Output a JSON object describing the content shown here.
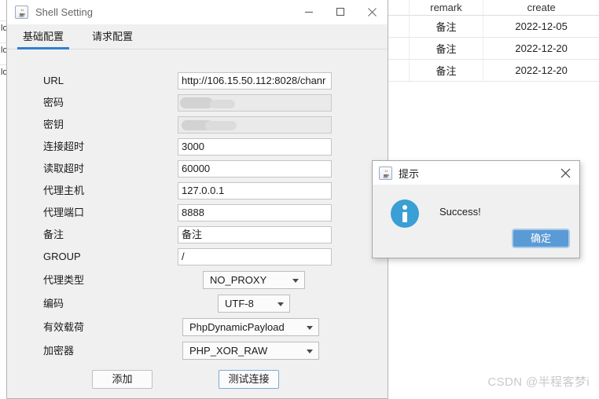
{
  "background": {
    "left_rows": [
      "lo",
      "lo",
      "lo"
    ],
    "table": {
      "headers": [
        "",
        "remark",
        "create"
      ],
      "rows": [
        [
          "",
          "备注",
          "2022-12-05"
        ],
        [
          "",
          "备注",
          "2022-12-20"
        ],
        [
          "",
          "备注",
          "2022-12-20"
        ]
      ]
    },
    "watermark": "CSDN @半程客梦i"
  },
  "shell_window": {
    "title": "Shell Setting",
    "app_icon": "java-coffee-cup-icon",
    "controls": {
      "minimize": "minimize-icon",
      "maximize": "maximize-icon",
      "close": "close-icon"
    },
    "tabs": [
      {
        "label": "基础配置",
        "active": true
      },
      {
        "label": "请求配置",
        "active": false
      }
    ],
    "fields": [
      {
        "label": "URL",
        "value": "http://106.15.50.112:8028/chanr",
        "type": "text"
      },
      {
        "label": "密码",
        "value": "",
        "type": "masked"
      },
      {
        "label": "密钥",
        "value": "",
        "type": "masked"
      },
      {
        "label": "连接超时",
        "value": "3000",
        "type": "text"
      },
      {
        "label": "读取超时",
        "value": "60000",
        "type": "text"
      },
      {
        "label": "代理主机",
        "value": "127.0.0.1",
        "type": "text"
      },
      {
        "label": "代理端口",
        "value": "8888",
        "type": "text"
      },
      {
        "label": "备注",
        "value": "备注",
        "type": "text"
      },
      {
        "label": "GROUP",
        "value": "/",
        "type": "text"
      }
    ],
    "selects": [
      {
        "label": "代理类型",
        "value": "NO_PROXY"
      },
      {
        "label": "编码",
        "value": "UTF-8"
      },
      {
        "label": "有效载荷",
        "value": "PhpDynamicPayload"
      },
      {
        "label": "加密器",
        "value": "PHP_XOR_RAW"
      }
    ],
    "buttons": {
      "add": "添加",
      "test": "测试连接"
    }
  },
  "dialog": {
    "title": "提示",
    "app_icon": "java-coffee-cup-icon",
    "message": "Success!",
    "ok_label": "确定",
    "close_icon": "close-icon",
    "info_icon": "info-circle-icon"
  },
  "colors": {
    "accent": "#2f7fd1",
    "button_primary": "#5b9bd5",
    "info": "#3a9fd4",
    "window_bg": "#f0f0f0"
  }
}
